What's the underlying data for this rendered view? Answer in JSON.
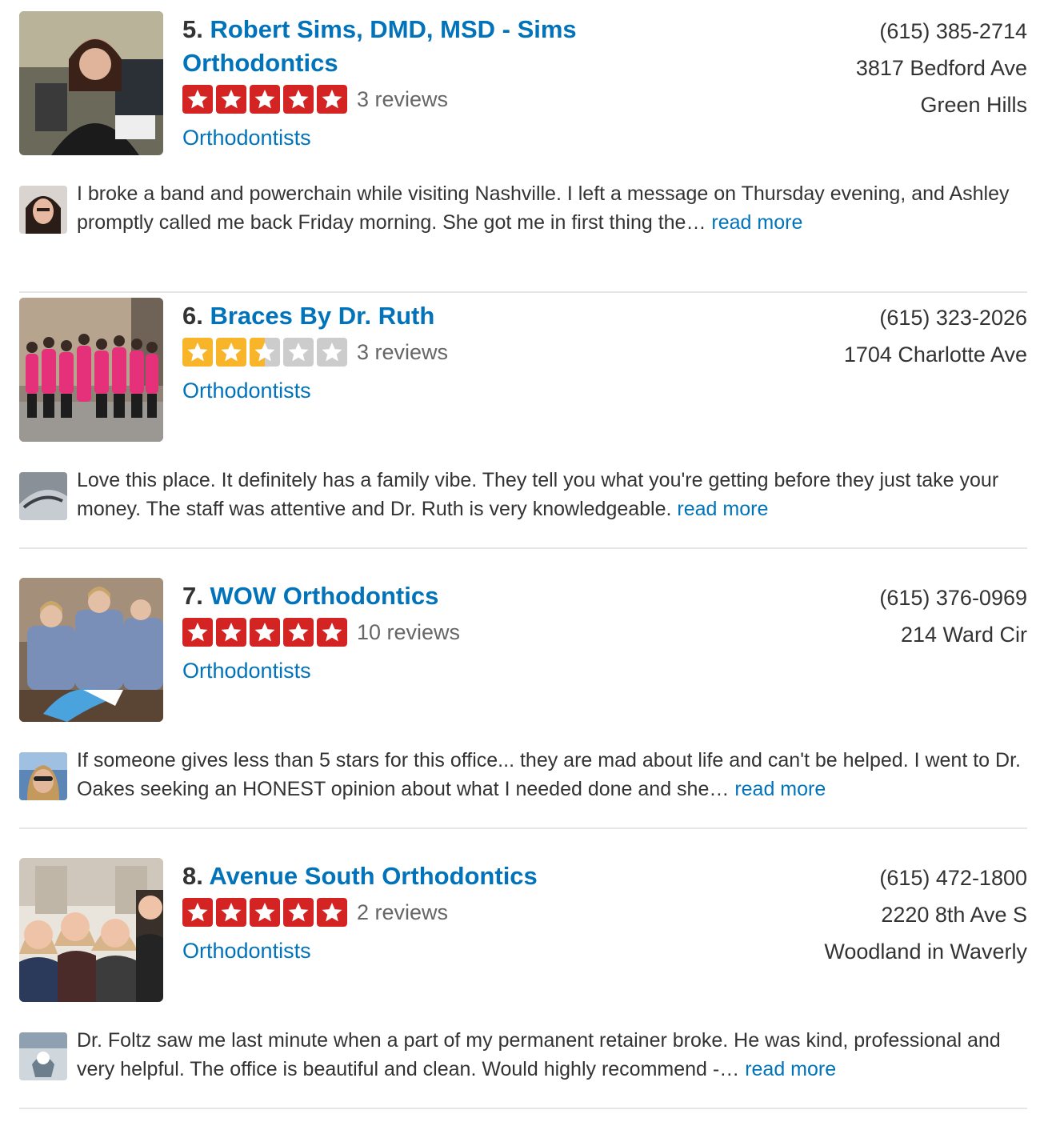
{
  "listings": [
    {
      "index": "5.",
      "name": "Robert Sims, DMD, MSD - Sims Orthodontics",
      "rating": 5,
      "star_color": "#d32323",
      "reviews": "3 reviews",
      "category": "Orthodontists",
      "phone": "(615) 385-2714",
      "address": "3817 Bedford Ave",
      "neighborhood": "Green Hills",
      "snippet": "I broke a band and powerchain while visiting Nashville. I left a message on Thursday evening, and Ashley promptly called me back Friday morning. She got me in first thing the…",
      "read_more": "read more"
    },
    {
      "index": "6.",
      "name": "Braces By Dr. Ruth",
      "rating": 2.5,
      "star_color": "#f9b52a",
      "reviews": "3 reviews",
      "category": "Orthodontists",
      "phone": "(615) 323-2026",
      "address": "1704 Charlotte Ave",
      "neighborhood": "",
      "snippet": "Love this place. It definitely has a family vibe. They tell you what you're getting before they just take your money. The staff was attentive and Dr. Ruth is very knowledgeable.",
      "read_more": "read more"
    },
    {
      "index": "7.",
      "name": "WOW Orthodontics",
      "rating": 5,
      "star_color": "#d32323",
      "reviews": "10 reviews",
      "category": "Orthodontists",
      "phone": "(615) 376-0969",
      "address": "214 Ward Cir",
      "neighborhood": "",
      "snippet": "If someone gives less than 5 stars for this office... they are mad about life and can't be helped. I went to Dr. Oakes seeking an HONEST opinion about what I needed done and she…",
      "read_more": "read more"
    },
    {
      "index": "8.",
      "name": "Avenue South Orthodontics",
      "rating": 5,
      "star_color": "#d32323",
      "reviews": "2 reviews",
      "category": "Orthodontists",
      "phone": "(615) 472-1800",
      "address": "2220 8th Ave S",
      "neighborhood": "Woodland in Waverly",
      "snippet": "Dr. Foltz saw me last minute when a part of my permanent retainer broke. He was kind, professional and very helpful. The office is beautiful and clean. Would highly recommend -…",
      "read_more": "read more"
    }
  ],
  "colors": {
    "link": "#0073bb",
    "text": "#333333",
    "muted": "#666666",
    "star_empty": "#cccccc",
    "divider": "#e6e6e6"
  },
  "icons": {
    "star": "star-icon",
    "photo": "business-photo",
    "avatar": "reviewer-avatar"
  }
}
